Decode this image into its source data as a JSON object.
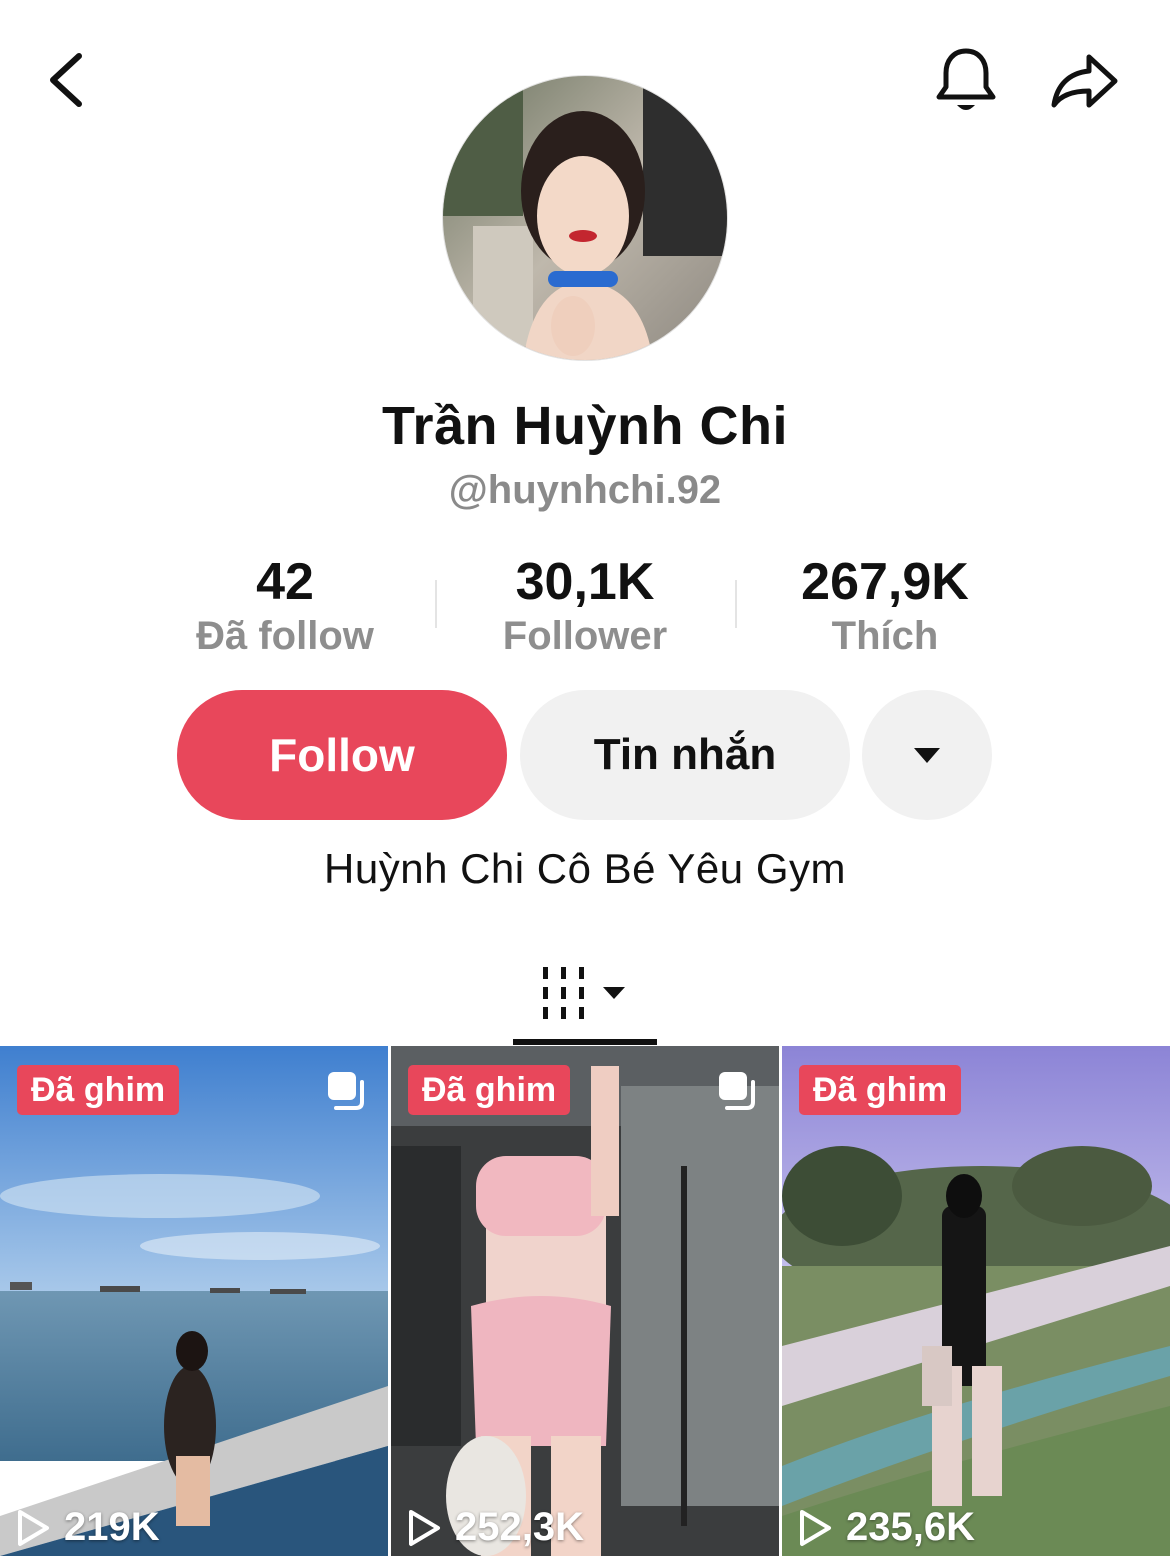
{
  "colors": {
    "accent": "#e8475b",
    "secondary_button_bg": "#f1f1f1",
    "muted_text": "#8a8a8a"
  },
  "header": {
    "back_icon": "chevron-left-icon",
    "bell_icon": "bell-icon",
    "share_icon": "share-arrow-icon"
  },
  "profile": {
    "name": "Trần Huỳnh Chi",
    "handle": "@huynhchi.92",
    "bio": "Huỳnh Chi Cô Bé Yêu Gym"
  },
  "stats": [
    {
      "value": "42",
      "label": "Đã follow"
    },
    {
      "value": "30,1K",
      "label": "Follower"
    },
    {
      "value": "267,9K",
      "label": "Thích"
    }
  ],
  "actions": {
    "follow_label": "Follow",
    "message_label": "Tin nhắn",
    "more_icon": "caret-down-icon"
  },
  "tabs": {
    "active_icon": "videos-grid-icon"
  },
  "videos": [
    {
      "badge": "Đã ghim",
      "views": "219K",
      "multi_photo": true
    },
    {
      "badge": "Đã ghim",
      "views": "252,3K",
      "multi_photo": true
    },
    {
      "badge": "Đã ghim",
      "views": "235,6K",
      "multi_photo": false
    }
  ]
}
